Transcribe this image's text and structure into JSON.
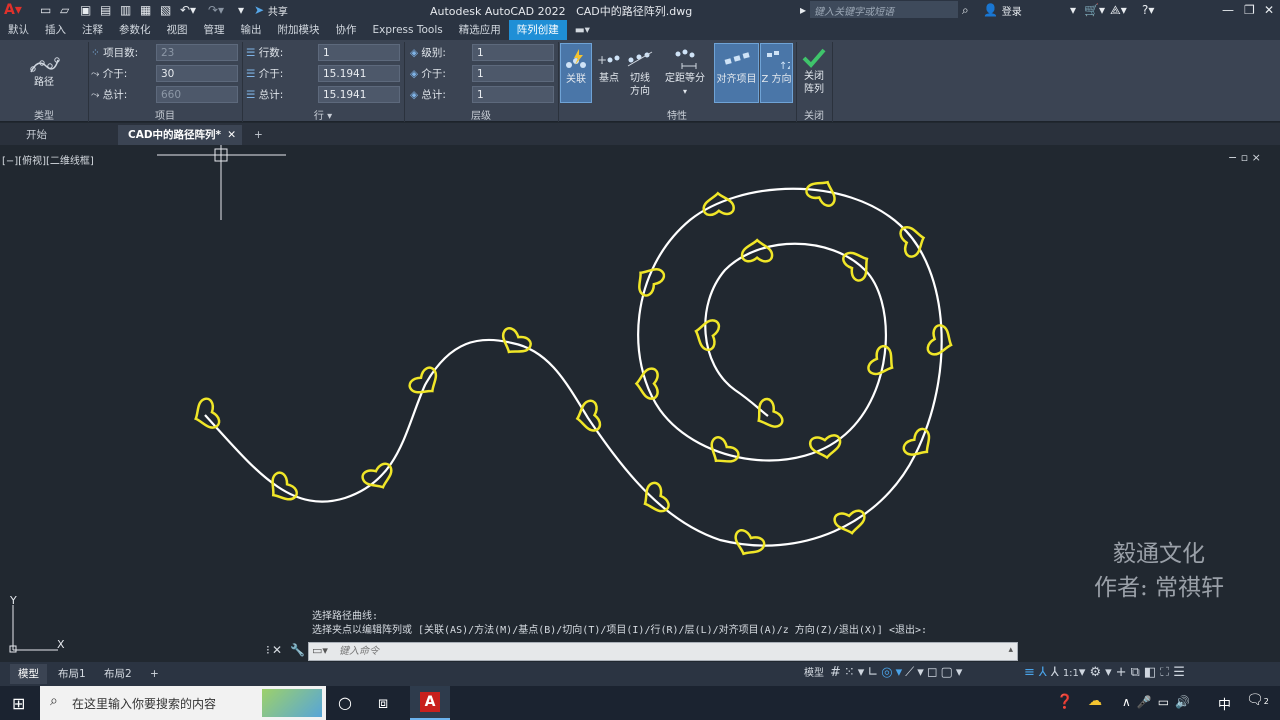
{
  "titlebar": {
    "app_name": "Autodesk AutoCAD 2022",
    "file_name": "CAD中的路径阵列.dwg",
    "search_placeholder": "键入关键字或短语",
    "login_label": "登录",
    "share_label": "共享"
  },
  "ribbon_tabs": [
    "默认",
    "插入",
    "注释",
    "参数化",
    "视图",
    "管理",
    "输出",
    "附加模块",
    "协作",
    "Express Tools",
    "精选应用",
    "阵列创建"
  ],
  "ribbon": {
    "type_panel": {
      "button_label": "路径",
      "panel_label": "类型"
    },
    "items_panel": {
      "count_label": "项目数:",
      "count_value": "23",
      "between_label": "介于:",
      "between_value": "30",
      "total_label": "总计:",
      "total_value": "660",
      "panel_label": "项目"
    },
    "rows_panel": {
      "count_label": "行数:",
      "count_value": "1",
      "between_label": "介于:",
      "between_value": "15.1941",
      "total_label": "总计:",
      "total_value": "15.1941",
      "panel_label": "行 ▾"
    },
    "levels_panel": {
      "count_label": "级别:",
      "count_value": "1",
      "between_label": "介于:",
      "between_value": "1",
      "total_label": "总计:",
      "total_value": "1",
      "panel_label": "层级"
    },
    "properties_panel": {
      "associative": "关联",
      "base_point": "基点",
      "tangent_1": "切线",
      "tangent_2": "方向",
      "measure": "定距等分",
      "align_items": "对齐项目",
      "z_direction": "Z 方向",
      "panel_label": "特性"
    },
    "close_panel": {
      "close_1": "关闭",
      "close_2": "阵列",
      "panel_label": "关闭"
    }
  },
  "doc_tabs": {
    "start": "开始",
    "current": "CAD中的路径阵列*",
    "add": "+"
  },
  "viewport": {
    "label": "[−][俯视][二维线框]",
    "axis_y": "Y",
    "axis_x": "X",
    "controls": "− ▫ ×"
  },
  "watermark": {
    "line1": "毅通文化",
    "line2": "作者: 常祺轩"
  },
  "command": {
    "history_1": "选择路径曲线:",
    "history_2": "选择夹点以编辑阵列或 [关联(AS)/方法(M)/基点(B)/切向(T)/项目(I)/行(R)/层(L)/对齐项目(A)/z 方向(Z)/退出(X)] <退出>:",
    "placeholder": "键入命令"
  },
  "status": {
    "model_tab": "模型",
    "layout1": "布局1",
    "layout2": "布局2",
    "add": "+",
    "model_label": "模型",
    "scale": "1:1"
  },
  "taskbar": {
    "search_text": "在这里输入你要搜索的内容",
    "ime": "中",
    "notification_count": "2"
  },
  "colors": {
    "accent": "#1f8fd6",
    "heart": "#f0e628",
    "path": "#ffffff",
    "canvas": "#212830"
  },
  "path_array": {
    "item_count": 23,
    "item_spacing": 30,
    "total_length": 660
  }
}
